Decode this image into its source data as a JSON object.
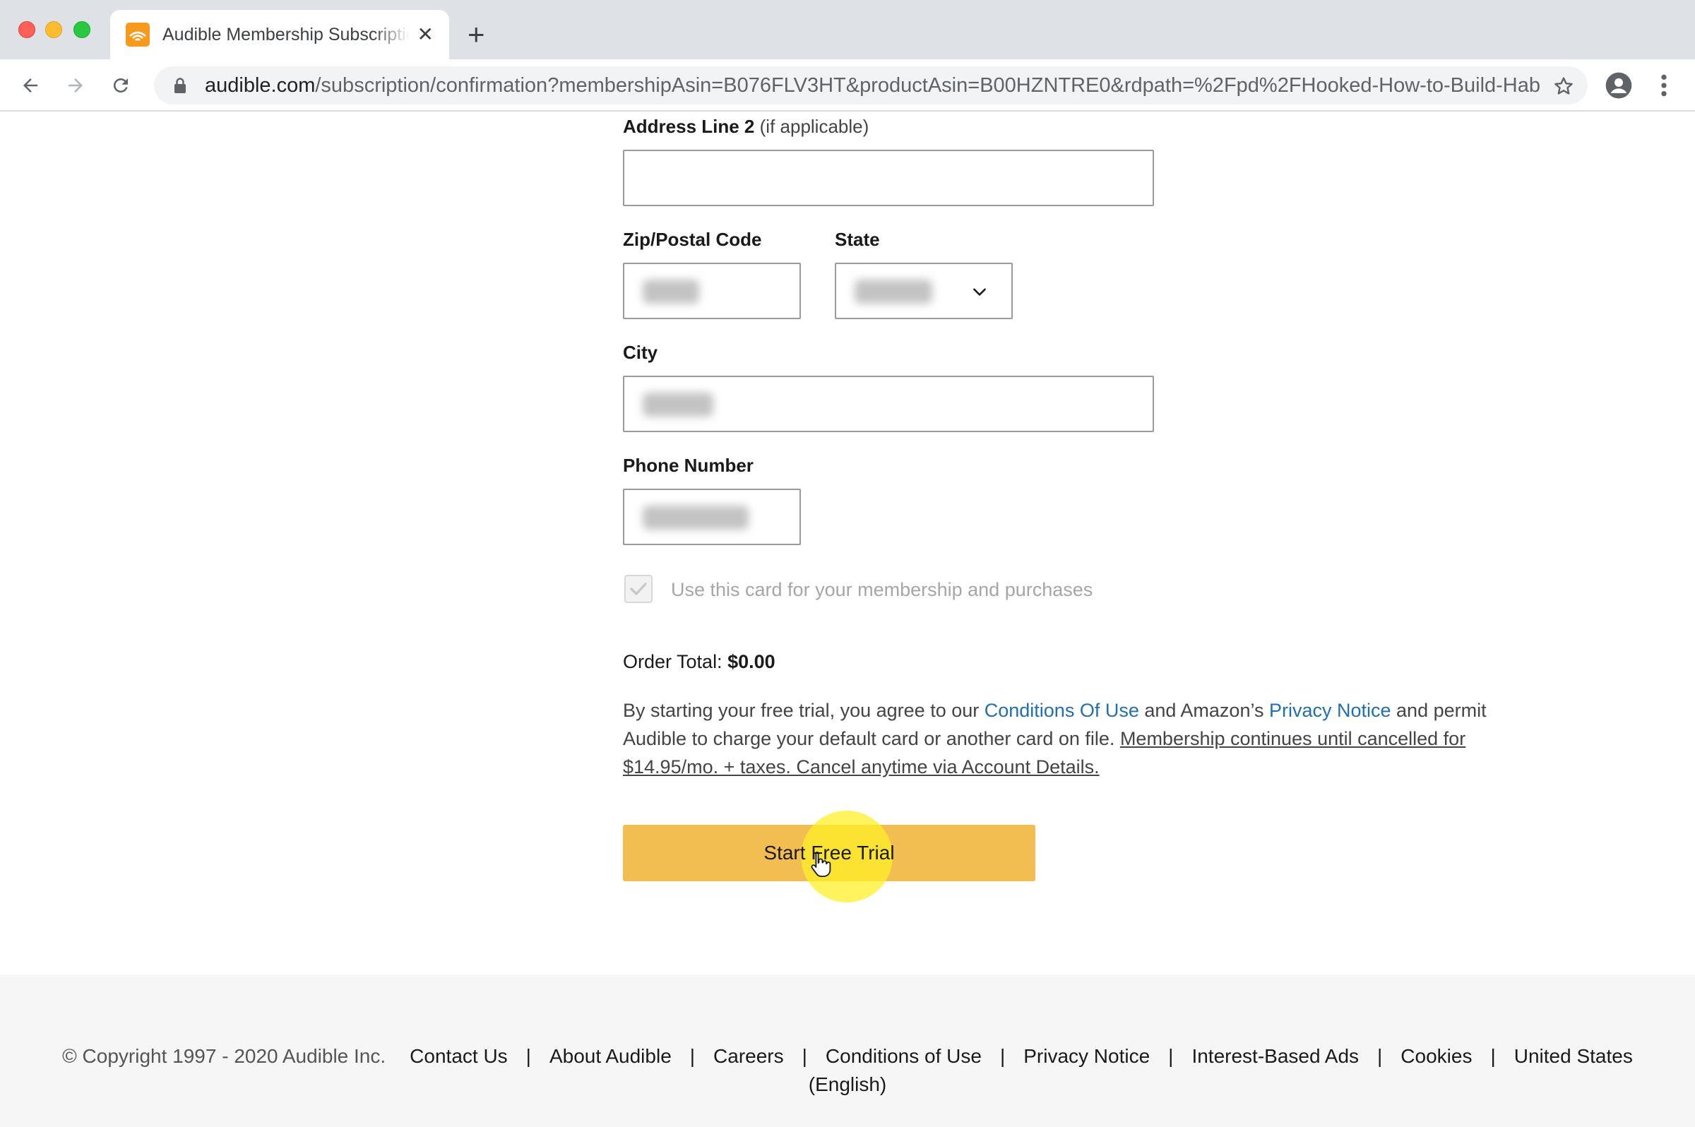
{
  "browser": {
    "tab_title": "Audible Membership Subscription",
    "tab_close": "✕",
    "new_tab": "+",
    "url_host": "audible.com",
    "url_path": "/subscription/confirmation?membershipAsin=B076FLV3HT&productAsin=B00HZNTRE0&rdpath=%2Fpd%2FHooked-How-to-Build-Hab..."
  },
  "form": {
    "address2_label": "Address Line 2",
    "address2_hint": "(if applicable)",
    "address2_value": "",
    "zip_label": "Zip/Postal Code",
    "state_label": "State",
    "city_label": "City",
    "phone_label": "Phone Number",
    "use_card_label": "Use this card for your membership and purchases",
    "use_card_checked": true
  },
  "order": {
    "total_label": "Order Total:",
    "total_value": "$0.00"
  },
  "legal": {
    "part1": "By starting your free trial, you agree to our ",
    "conditions_link": "Conditions Of Use",
    "part2": " and Amazon’s ",
    "privacy_link": "Privacy Notice",
    "part3": " and permit Audible to charge your default card or another card on file. ",
    "membership_note": "Membership continues until cancelled for $14.95/mo. + taxes. Cancel anytime via Account Details."
  },
  "cta": {
    "label": "Start Free Trial"
  },
  "footer": {
    "copyright": "© Copyright 1997 - 2020 Audible Inc.",
    "links": [
      "Contact Us",
      "About Audible",
      "Careers",
      "Conditions of Use",
      "Privacy Notice",
      "Interest-Based Ads",
      "Cookies",
      "United States"
    ],
    "separator": "|",
    "locale": "(English)"
  },
  "colors": {
    "cta": "#f2bd51",
    "link": "#1f6fb2",
    "footer_bg": "#f6f6f6",
    "cursor_highlight": "#fff028"
  },
  "icons": [
    "audible-favicon",
    "back-arrow-icon",
    "forward-arrow-icon",
    "reload-icon",
    "lock-icon",
    "star-icon",
    "profile-icon",
    "more-vert-icon",
    "chevron-down-icon",
    "checkmark-icon",
    "hand-cursor-icon"
  ]
}
